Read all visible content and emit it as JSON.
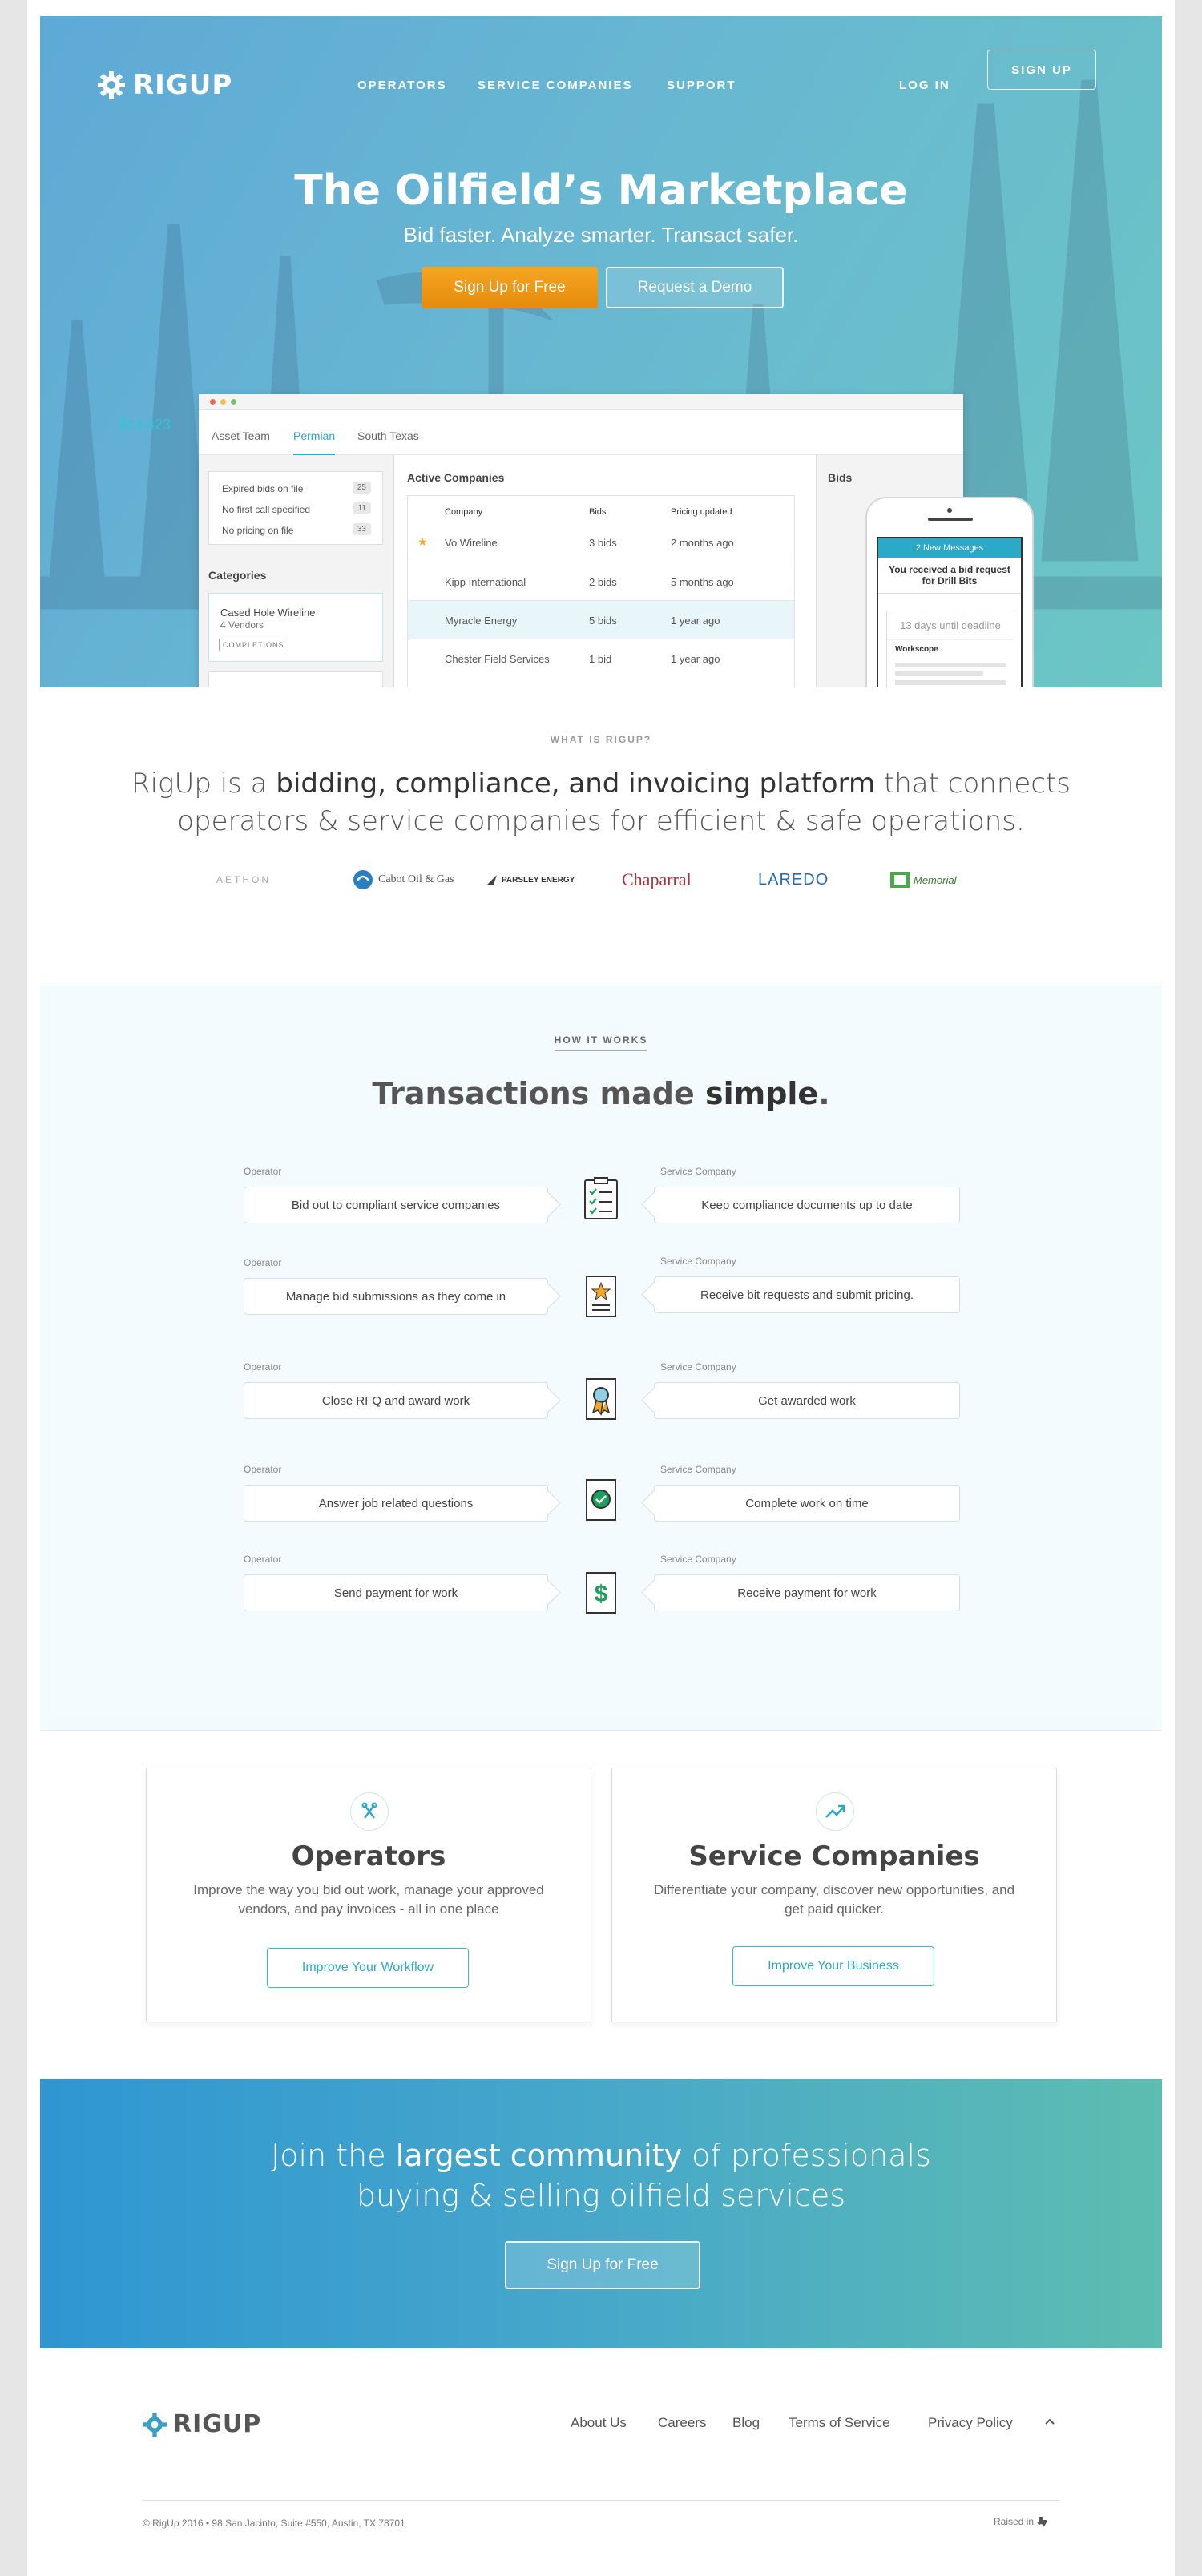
{
  "brand": {
    "name": "RIGUP",
    "accent": "#2aa9c9",
    "orange": "#f5a623"
  },
  "nav": {
    "links": [
      "OPERATORS",
      "SERVICE COMPANIES",
      "SUPPORT"
    ],
    "login": "LOG IN",
    "signup": "SIGN UP"
  },
  "hero": {
    "title": "The Oilfield’s Marketplace",
    "subtitle": "Bid faster. Analyze smarter. Transact safer.",
    "primary_cta": "Sign Up for Free",
    "secondary_cta": "Request a Demo",
    "float_value": "$14,423"
  },
  "dashboard": {
    "tabs": [
      "Asset Team",
      "Permian",
      "South Texas"
    ],
    "active_tab": "Permian",
    "filters": [
      {
        "label": "Expired bids on file",
        "count": "25"
      },
      {
        "label": "No first call specified",
        "count": "11"
      },
      {
        "label": "No pricing on file",
        "count": "33"
      }
    ],
    "categories_title": "Categories",
    "category": {
      "name": "Cased Hole Wireline",
      "vendors": "4 Vendors",
      "tag": "COMPLETIONS"
    },
    "active_companies_title": "Active Companies",
    "columns": [
      "Company",
      "Bids",
      "Pricing  updated"
    ],
    "rows": [
      {
        "company": "Vo Wireline",
        "bids": "3 bids",
        "updated": "2 months ago",
        "starred": true
      },
      {
        "company": "Kipp International",
        "bids": "2 bids",
        "updated": "5 months ago",
        "starred": false
      },
      {
        "company": "Myracle Energy",
        "bids": "5 bids",
        "updated": "1 year ago",
        "starred": false
      },
      {
        "company": "Chester Field Services",
        "bids": "1 bid",
        "updated": "1 year ago",
        "starred": false
      }
    ],
    "bids_title": "Bids"
  },
  "phone": {
    "banner": "2 New Messages",
    "message": "You received a bid request for Drill Bits",
    "deadline": "13 days until deadline",
    "workscope": "Workscope"
  },
  "what_is": {
    "eyebrow": "WHAT IS RIGUP?",
    "lead_pre": "RigUp is a ",
    "lead_bold": "bidding, compliance, and invoicing platform",
    "lead_post": " that connects operators & service companies for efficient & safe operations.",
    "logos": [
      "AETHON",
      "Cabot Oil & Gas",
      "PARSLEY ENERGY",
      "Chaparral",
      "LAREDO",
      "Memorial"
    ]
  },
  "how": {
    "eyebrow": "HOW IT WORKS",
    "title_pre": "Transactions made ",
    "title_bold": "simple",
    "title_post": ".",
    "operator_label": "Operator",
    "service_label": "Service Company",
    "steps": [
      {
        "operator": "Bid out to compliant service companies",
        "service": "Keep compliance documents up to date",
        "icon": "clipboard-icon"
      },
      {
        "operator": "Manage bid submissions as they come in",
        "service": "Receive bit requests and submit pricing.",
        "icon": "star-document-icon"
      },
      {
        "operator": "Close RFQ and award work",
        "service": "Get awarded work",
        "icon": "award-ribbon-icon"
      },
      {
        "operator": "Answer job related questions",
        "service": "Complete work on time",
        "icon": "check-circle-icon"
      },
      {
        "operator": "Send payment for work",
        "service": "Receive payment for work",
        "icon": "dollar-document-icon"
      }
    ]
  },
  "cards": [
    {
      "title": "Operators",
      "desc": "Improve the way you bid out work, manage your approved vendors, and pay invoices - all in one place",
      "cta": "Improve Your Workflow",
      "icon": "tools-icon"
    },
    {
      "title": "Service Companies",
      "desc": "Differentiate your company, discover new opportunities, and get paid quicker.",
      "cta": "Improve Your Business",
      "icon": "trend-up-icon"
    }
  ],
  "cta": {
    "line1_pre": "Join the ",
    "line1_bold": "largest community",
    "line1_post": " of professionals",
    "line2": "buying & selling oilfield services",
    "button": "Sign Up for Free"
  },
  "footer": {
    "links": [
      "About Us",
      "Careers",
      "Blog",
      "Terms of Service",
      "Privacy Policy"
    ],
    "copyright": "© RigUp 2016 • 98 San Jacinto, Suite #550, Austin, TX 78701",
    "raised": "Raised in"
  }
}
